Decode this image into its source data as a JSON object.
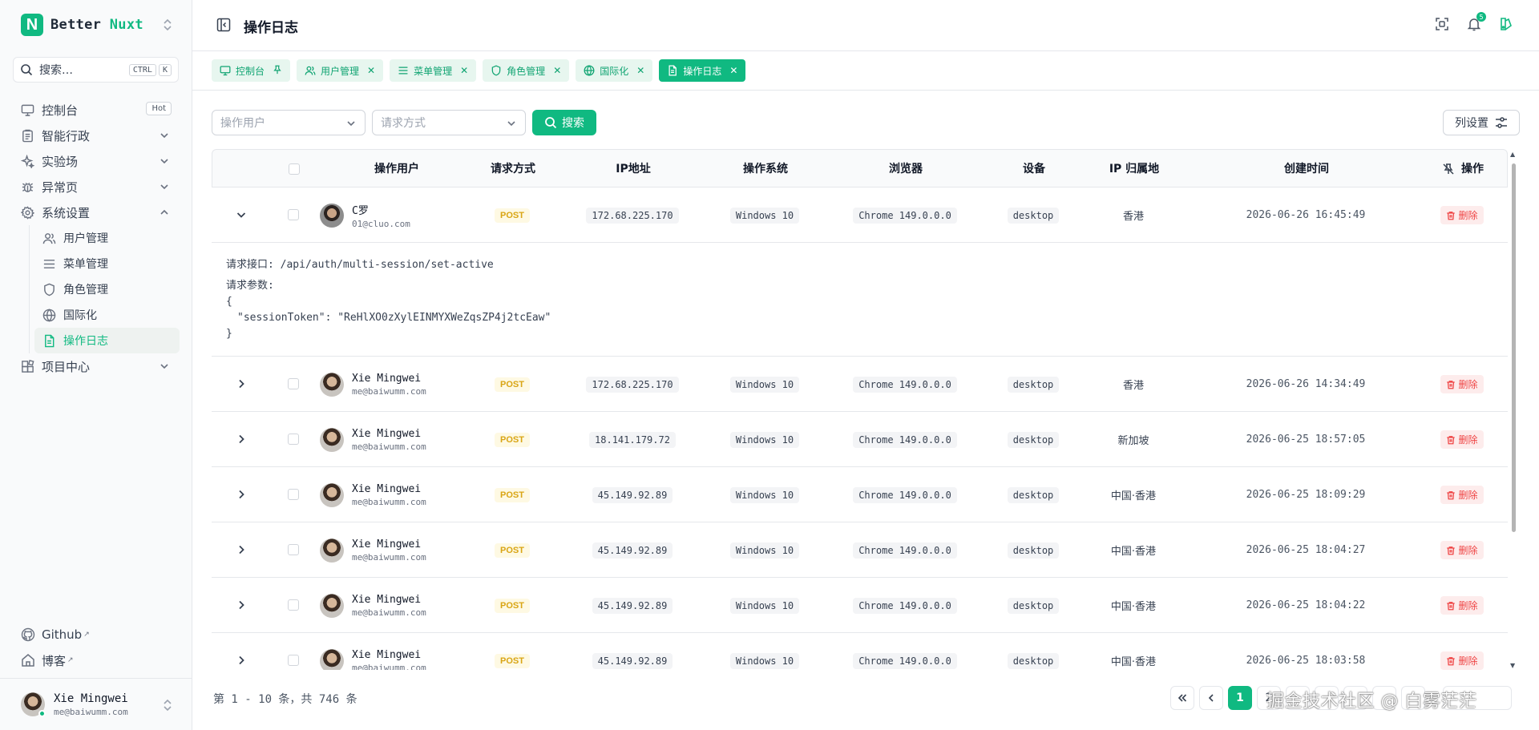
{
  "brand": {
    "name_part1": "Better",
    "name_part2": "Nuxt",
    "logo_letter": "N",
    "accent_color": "#10b981"
  },
  "search": {
    "placeholder": "搜索…",
    "kbd1": "CTRL",
    "kbd2": "K"
  },
  "sidebar": {
    "items": [
      {
        "label": "控制台",
        "icon": "monitor-icon",
        "badge": "Hot"
      },
      {
        "label": "智能行政",
        "icon": "clipboard-icon"
      },
      {
        "label": "实验场",
        "icon": "sparkles-icon"
      },
      {
        "label": "异常页",
        "icon": "bug-icon"
      },
      {
        "label": "系统设置",
        "icon": "gear-icon"
      }
    ],
    "sub_items": [
      {
        "label": "用户管理",
        "icon": "users-icon"
      },
      {
        "label": "菜单管理",
        "icon": "menu-icon"
      },
      {
        "label": "角色管理",
        "icon": "shield-icon"
      },
      {
        "label": "国际化",
        "icon": "globe-icon"
      },
      {
        "label": "操作日志",
        "icon": "file-text-icon"
      }
    ],
    "project": {
      "label": "项目中心",
      "icon": "grid-icon"
    },
    "footer_links": [
      {
        "label": "Github",
        "icon": "github-icon"
      },
      {
        "label": "博客",
        "icon": "home-icon"
      }
    ],
    "user": {
      "name": "Xie Mingwei",
      "email": "me@baiwumm.com"
    }
  },
  "header": {
    "title": "操作日志",
    "notification_count": "5"
  },
  "tabs": [
    {
      "label": "控制台",
      "icon": "monitor-icon",
      "closable": false
    },
    {
      "label": "用户管理",
      "icon": "users-icon",
      "closable": true
    },
    {
      "label": "菜单管理",
      "icon": "menu-icon",
      "closable": true
    },
    {
      "label": "角色管理",
      "icon": "shield-icon",
      "closable": true
    },
    {
      "label": "国际化",
      "icon": "globe-icon",
      "closable": true
    },
    {
      "label": "操作日志",
      "icon": "file-text-icon",
      "closable": true,
      "active": true
    }
  ],
  "filters": {
    "user_placeholder": "操作用户",
    "method_placeholder": "请求方式",
    "search_label": "搜索",
    "columns_label": "列设置"
  },
  "table": {
    "headers": {
      "user": "操作用户",
      "method": "请求方式",
      "ip": "IP地址",
      "os": "操作系统",
      "browser": "浏览器",
      "device": "设备",
      "location": "IP 归属地",
      "created": "创建时间",
      "actions": "操作"
    },
    "delete_label": "删除",
    "rows": [
      {
        "name": "C罗",
        "email": "01@cluo.com",
        "method": "POST",
        "ip": "172.68.225.170",
        "os": "Windows 10",
        "browser": "Chrome 149.0.0.0",
        "device": "desktop",
        "location": "香港",
        "created": "2026-06-26 16:45:49",
        "expanded": true
      },
      {
        "name": "Xie Mingwei",
        "email": "me@baiwumm.com",
        "method": "POST",
        "ip": "172.68.225.170",
        "os": "Windows 10",
        "browser": "Chrome 149.0.0.0",
        "device": "desktop",
        "location": "香港",
        "created": "2026-06-26 14:34:49"
      },
      {
        "name": "Xie Mingwei",
        "email": "me@baiwumm.com",
        "method": "POST",
        "ip": "18.141.179.72",
        "os": "Windows 10",
        "browser": "Chrome 149.0.0.0",
        "device": "desktop",
        "location": "新加坡",
        "created": "2026-06-25 18:57:05"
      },
      {
        "name": "Xie Mingwei",
        "email": "me@baiwumm.com",
        "method": "POST",
        "ip": "45.149.92.89",
        "os": "Windows 10",
        "browser": "Chrome 149.0.0.0",
        "device": "desktop",
        "location": "中国·香港",
        "created": "2026-06-25 18:09:29"
      },
      {
        "name": "Xie Mingwei",
        "email": "me@baiwumm.com",
        "method": "POST",
        "ip": "45.149.92.89",
        "os": "Windows 10",
        "browser": "Chrome 149.0.0.0",
        "device": "desktop",
        "location": "中国·香港",
        "created": "2026-06-25 18:04:27"
      },
      {
        "name": "Xie Mingwei",
        "email": "me@baiwumm.com",
        "method": "POST",
        "ip": "45.149.92.89",
        "os": "Windows 10",
        "browser": "Chrome 149.0.0.0",
        "device": "desktop",
        "location": "中国·香港",
        "created": "2026-06-25 18:04:22"
      },
      {
        "name": "Xie Mingwei",
        "email": "me@baiwumm.com",
        "method": "POST",
        "ip": "45.149.92.89",
        "os": "Windows 10",
        "browser": "Chrome 149.0.0.0",
        "device": "desktop",
        "location": "中国·香港",
        "created": "2026-06-25 18:03:58"
      }
    ],
    "detail": {
      "endpoint_label": "请求接口:",
      "endpoint": "/api/auth/multi-session/set-active",
      "params_label": "请求参数:",
      "params_open": "{",
      "params_line": "\"sessionToken\": \"ReHlXO0zXylEINMYXWeZqsZP4j2tcEaw\"",
      "params_close": "}"
    }
  },
  "pagination": {
    "summary": "第 1 - 10 条，共 746 条",
    "current_page": "1",
    "next_page": "2"
  },
  "watermark": "掘金技术社区 @ 白雾茫茫"
}
